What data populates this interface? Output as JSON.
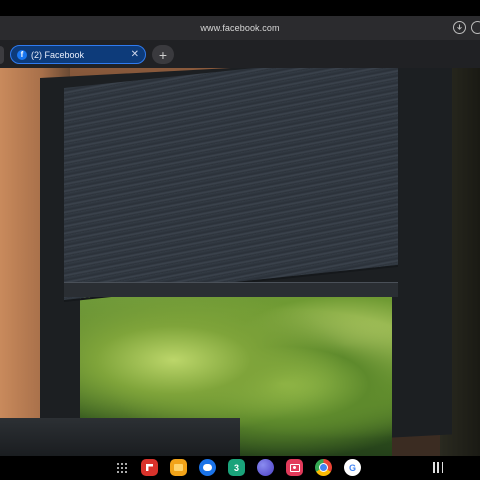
{
  "browser": {
    "url": "www.facebook.com",
    "tab": {
      "title": "(2) Facebook",
      "favicon": "facebook-icon",
      "close_glyph": "✕"
    },
    "new_tab_glyph": "+",
    "download_icon": "download-icon",
    "reload_icon": "reload-icon"
  },
  "content": {
    "description_icon": "photo-window-blind"
  },
  "taskbar": {
    "apps_icon": "apps-grid-icon",
    "dock": [
      {
        "name": "flipboard-icon",
        "color": "#d9322b",
        "glyph": ""
      },
      {
        "name": "files-icon",
        "color": "#f2a318",
        "glyph": ""
      },
      {
        "name": "messages-icon",
        "color": "#ffffff",
        "glyph": ""
      },
      {
        "name": "calendar-icon",
        "color": "#1aa37a",
        "glyph": "3"
      },
      {
        "name": "internet-icon",
        "color": "#5b5bd6",
        "glyph": ""
      },
      {
        "name": "screen-recorder-icon",
        "color": "#e23a5a",
        "glyph": ""
      },
      {
        "name": "chrome-icon",
        "color": "#ffffff",
        "glyph": ""
      },
      {
        "name": "google-icon",
        "color": "#ffffff",
        "glyph": "G"
      }
    ],
    "recents_icon": "recents-icon"
  }
}
